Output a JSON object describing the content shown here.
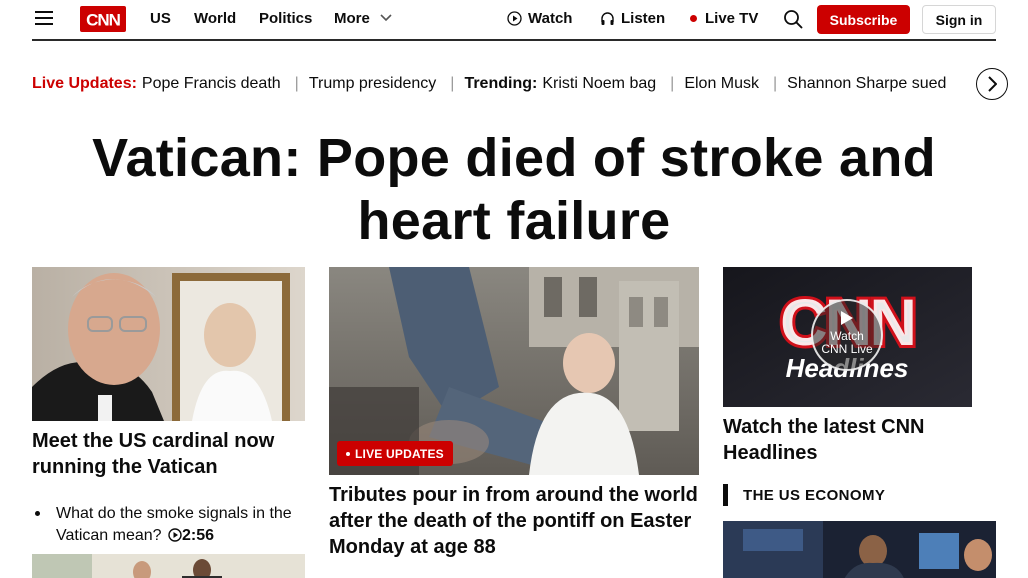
{
  "nav": {
    "menu_icon": "hamburger-menu-icon",
    "logo": "CNN",
    "links": [
      "US",
      "World",
      "Politics",
      "More"
    ],
    "watch": "Watch",
    "listen": "Listen",
    "live_tv": "Live TV",
    "subscribe": "Subscribe",
    "sign_in": "Sign in"
  },
  "ticker": {
    "live_label": "Live Updates:",
    "live_item": "Pope Francis death",
    "item2": "Trump presidency",
    "trending_label": "Trending:",
    "trending_item": "Kristi Noem bag",
    "item4": "Elon Musk",
    "item5": "Shannon Sharpe sued"
  },
  "headline": "Vatican: Pope died of stroke and heart failure",
  "left_card": {
    "title": "Meet the US cardinal now running the Vatican",
    "bullet": "What do the smoke signals in the Vatican mean?",
    "duration": "2:56"
  },
  "center_card": {
    "badge": "LIVE UPDATES",
    "title": "Tributes pour in from around the world after the death of the pontiff on Easter Monday at age 88"
  },
  "right_card": {
    "video_title": "Watch the latest CNN Headlines",
    "play_label_1": "Watch",
    "play_label_2": "CNN Live",
    "brand_text": "Headlines",
    "section_heading": "THE US ECONOMY"
  },
  "colors": {
    "brand_red": "#cc0000",
    "text": "#0c0c0c"
  }
}
